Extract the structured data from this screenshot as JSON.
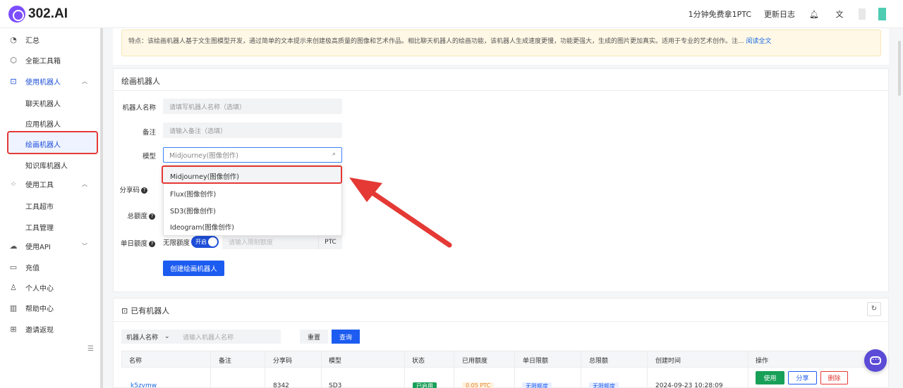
{
  "header": {
    "logo_text": "302.AI",
    "free_ptc": "1分钟免费拿1PTC",
    "changelog": "更新日志"
  },
  "sidebar": {
    "items": [
      {
        "label": "汇总",
        "icon": "dashboard-icon"
      },
      {
        "label": "全能工具箱",
        "icon": "cube-icon"
      },
      {
        "label": "使用机器人",
        "icon": "robot-icon"
      },
      {
        "label": "聊天机器人"
      },
      {
        "label": "应用机器人"
      },
      {
        "label": "绘画机器人"
      },
      {
        "label": "知识库机器人"
      },
      {
        "label": "使用工具",
        "icon": "grid-icon"
      },
      {
        "label": "工具超市"
      },
      {
        "label": "工具管理"
      },
      {
        "label": "使用API",
        "icon": "cloud-icon"
      },
      {
        "label": "充值",
        "icon": "wallet-icon"
      },
      {
        "label": "个人中心",
        "icon": "user-icon"
      },
      {
        "label": "帮助中心",
        "icon": "book-icon"
      },
      {
        "label": "邀请返现",
        "icon": "gift-icon"
      }
    ]
  },
  "notice": {
    "text": "特点：该绘画机器人基于文生图模型开发，通过简单的文本提示来创建极高质量的图像和艺术作品。相比聊天机器人的绘画功能，该机器人生成速度更慢，功能更强大，生成的图片更加真实。适用于专业的艺术创作。注...",
    "link": "阅读全文"
  },
  "form": {
    "title": "绘画机器人",
    "name_label": "机器人名称",
    "name_placeholder": "请填写机器人名称（选填）",
    "remark_label": "备注",
    "remark_placeholder": "请输入备注（选填）",
    "model_label": "模型",
    "model_value": "Midjourney(图像创作)",
    "share_label": "分享码",
    "total_label": "总额度",
    "daily_label": "单日额度",
    "unlimited_label": "无限额度",
    "toggle_text": "开启",
    "limit_placeholder": "请输入限制额度",
    "unit": "PTC",
    "create_button": "创建绘画机器人",
    "model_options": [
      "Midjourney(图像创作)",
      "Flux(图像创作)",
      "SD3(图像创作)",
      "Ideogram(图像创作)"
    ]
  },
  "list": {
    "title": "已有机器人",
    "filter_field": "机器人名称",
    "filter_placeholder": "请输入机器人名称",
    "reset_button": "重置",
    "query_button": "查询",
    "columns": [
      "名称",
      "备注",
      "分享码",
      "模型",
      "状态",
      "已用额度",
      "单日限额",
      "总限额",
      "创建时间",
      "操作"
    ],
    "row": {
      "name": "k5zvmw",
      "share_code": "8342",
      "model": "SD3",
      "status": "已启用",
      "used": "0.05 PTC",
      "daily": "无限额度",
      "total": "无限额度",
      "created": "2024-09-23 10:28:09",
      "use_button": "使用",
      "share_button": "分享",
      "delete_button": "删除"
    }
  },
  "colors": {
    "primary": "#1d5cf0",
    "highlight_red": "#e53935",
    "success": "#18a058"
  }
}
